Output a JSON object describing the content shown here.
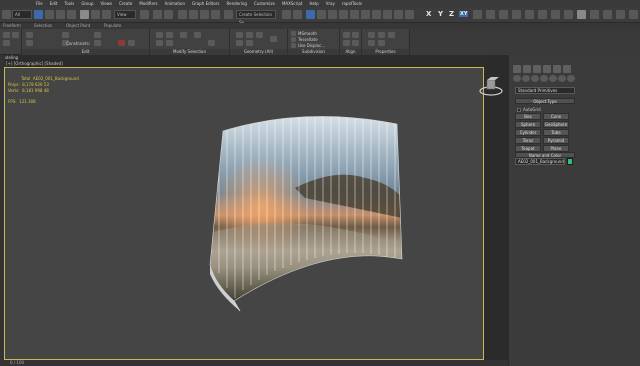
{
  "menubar": {
    "items": [
      "File",
      "Edit",
      "Tools",
      "Group",
      "Views",
      "Create",
      "Modifiers",
      "Animation",
      "Graph Editors",
      "Rendering",
      "Customize",
      "MAXScript",
      "Help",
      "Vray",
      "rapidTools"
    ]
  },
  "toolbar": {
    "workspace_select": "All",
    "view_select": "View",
    "named_sets": "Create Selection Se",
    "axes": [
      "X",
      "Y",
      "Z",
      "XY"
    ]
  },
  "ribbon_tabs": [
    "Freeform",
    "Selection",
    "Object Paint",
    "Populate"
  ],
  "ribbon": {
    "groups": [
      {
        "label": "Edit"
      },
      {
        "label": "Modify Selection"
      },
      {
        "label": "Geometry (All)"
      },
      {
        "label": "Subdivision"
      },
      {
        "label": "Align"
      },
      {
        "label": "Properties"
      }
    ],
    "constraints_label": "Constraints:",
    "msmooth_label": "MSmooth",
    "tessellate_label": "Tessellate",
    "use_displace_label": "Use Displac..."
  },
  "modeling_label": "Modeling",
  "viewport": {
    "label": "[+] [Orthographic] [Shaded]",
    "stats": [
      {
        "key": "Total",
        "value": "AE02_001_Background"
      },
      {
        "key": "Polys:",
        "value": "8,178 626  53"
      },
      {
        "key": "Verts:",
        "value": "8,181 998  48"
      },
      {
        "key": "FPS:",
        "value": "121.308"
      }
    ]
  },
  "command_panel": {
    "category_dropdown": "Standard Primitives",
    "object_type_header": "Object Type",
    "autogrid_label": "AutoGrid",
    "buttons": [
      "Box",
      "Cone",
      "Sphere",
      "GeoSphere",
      "Cylinder",
      "Tube",
      "Torus",
      "Pyramid",
      "Teapot",
      "Plane"
    ],
    "name_color_header": "Name and Color",
    "object_name": "AE02_001_Background",
    "object_color": "#2fbf7a"
  },
  "statusbar": {
    "frame": "0 / 100"
  }
}
